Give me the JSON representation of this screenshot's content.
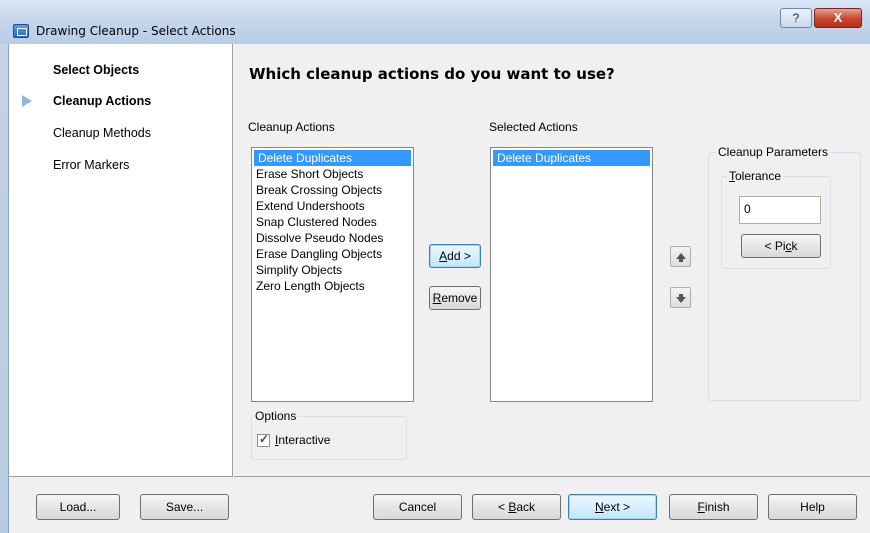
{
  "window": {
    "title": "Drawing Cleanup - Select Actions",
    "help_glyph": "?",
    "close_glyph": "X"
  },
  "nav": {
    "items": [
      {
        "label": "Select Objects"
      },
      {
        "label": "Cleanup Actions"
      },
      {
        "label": "Cleanup Methods"
      },
      {
        "label": "Error Markers"
      }
    ]
  },
  "main": {
    "heading": "Which cleanup actions do you want to use?",
    "cleanup_actions_label": "Cleanup Actions",
    "selected_actions_label": "Selected Actions",
    "cleanup_actions": [
      "Delete Duplicates",
      "Erase Short Objects",
      "Break Crossing Objects",
      "Extend Undershoots",
      "Snap Clustered Nodes",
      "Dissolve Pseudo Nodes",
      "Erase Dangling Objects",
      "Simplify Objects",
      "Zero Length Objects"
    ],
    "selected_actions": [
      "Delete Duplicates"
    ],
    "add_button": {
      "pre": "",
      "key": "A",
      "post": "dd >"
    },
    "remove_button": {
      "pre": "",
      "key": "R",
      "post": "emove"
    },
    "options": {
      "label": "Options",
      "interactive": {
        "pre": "",
        "key": "I",
        "post": "nteractive",
        "checked": true
      }
    },
    "parameters": {
      "label": "Cleanup Parameters",
      "tolerance_label": {
        "pre": "",
        "key": "T",
        "post": "olerance"
      },
      "tolerance_value": "0",
      "pick_button": {
        "pre": "< Pi",
        "key": "c",
        "post": "k"
      }
    }
  },
  "footer": {
    "load": "Load...",
    "save": "Save...",
    "cancel": "Cancel",
    "back": {
      "pre": "< ",
      "key": "B",
      "post": "ack"
    },
    "next": {
      "pre": "",
      "key": "N",
      "post": "ext >"
    },
    "finish": {
      "pre": "",
      "key": "F",
      "post": "inish"
    },
    "help": "Help"
  }
}
